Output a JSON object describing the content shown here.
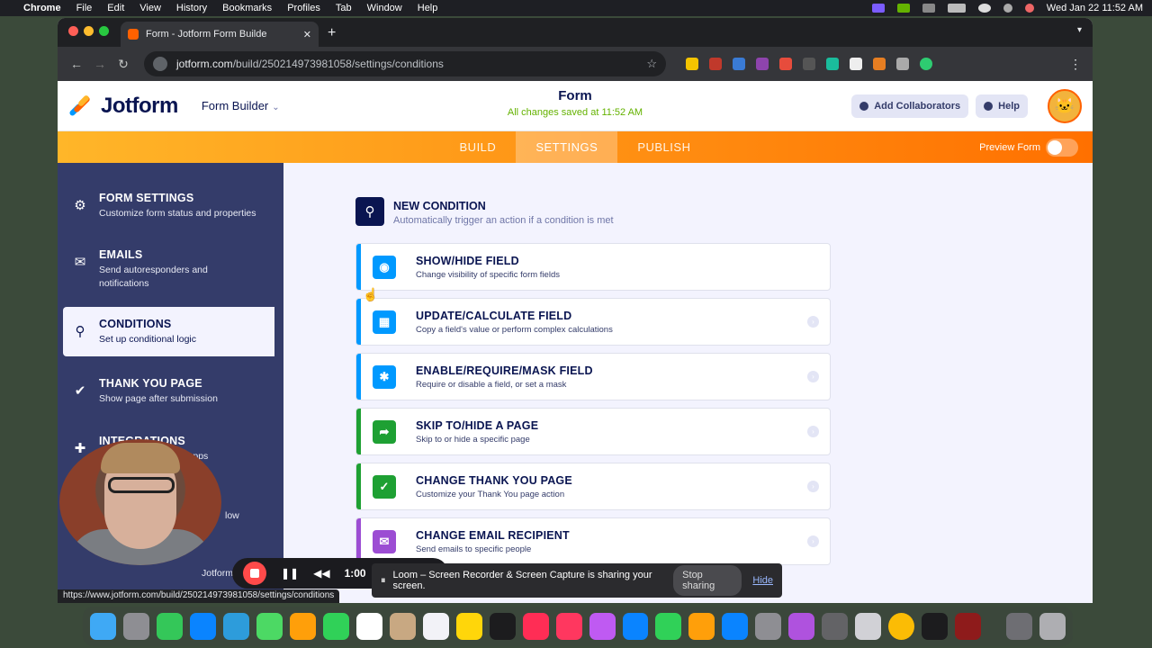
{
  "menubar": {
    "app": "Chrome",
    "items": [
      "File",
      "Edit",
      "View",
      "History",
      "Bookmarks",
      "Profiles",
      "Tab",
      "Window",
      "Help"
    ],
    "clock": "Wed Jan 22  11:52 AM"
  },
  "browser": {
    "tab_title": "Form - Jotform Form Builde",
    "new_tab": "+",
    "url_host": "jotform.com",
    "url_path": "/build/250214973981058/settings/conditions",
    "status_url": "https://www.jotform.com/build/250214973981058/settings/conditions"
  },
  "header": {
    "brand": "Jotform",
    "form_builder": "Form Builder",
    "form_title": "Form",
    "save_status": "All changes saved at 11:52 AM",
    "add_collaborators": "Add Collaborators",
    "help": "Help"
  },
  "nav": {
    "tabs": [
      "BUILD",
      "SETTINGS",
      "PUBLISH"
    ],
    "active_tab": "SETTINGS",
    "preview_label": "Preview Form",
    "preview_on": false
  },
  "sidebar": {
    "items": [
      {
        "title": "FORM SETTINGS",
        "desc": "Customize form status and properties",
        "icon": "gear-icon"
      },
      {
        "title": "EMAILS",
        "desc": "Send autoresponders and notifications",
        "icon": "mail-icon"
      },
      {
        "title": "CONDITIONS",
        "desc": "Set up conditional logic",
        "icon": "sitemap-icon",
        "active": true
      },
      {
        "title": "THANK YOU PAGE",
        "desc": "Show page after submission",
        "icon": "check-circle-icon"
      },
      {
        "title": "INTEGRATIONS",
        "desc": "to other apps",
        "icon": "puzzle-icon"
      },
      {
        "title": "",
        "desc": "low",
        "icon": ""
      },
      {
        "title": "",
        "desc": "Jotform",
        "icon": ""
      }
    ]
  },
  "content": {
    "new_condition_title": "NEW CONDITION",
    "new_condition_desc": "Automatically trigger an action if a condition is met",
    "cards": [
      {
        "title": "SHOW/HIDE FIELD",
        "desc": "Change visibility of specific form fields",
        "color": "#0099ff",
        "icon": "eye-icon"
      },
      {
        "title": "UPDATE/CALCULATE FIELD",
        "desc": "Copy a field's value or perform complex calculations",
        "color": "#0099ff",
        "icon": "calculator-icon"
      },
      {
        "title": "ENABLE/REQUIRE/MASK FIELD",
        "desc": "Require or disable a field, or set a mask",
        "color": "#0099ff",
        "icon": "asterisk-icon"
      },
      {
        "title": "SKIP TO/HIDE A PAGE",
        "desc": "Skip to or hide a specific page",
        "color": "#1ea033",
        "icon": "share-arrow-icon"
      },
      {
        "title": "CHANGE THANK YOU PAGE",
        "desc": "Customize your Thank You page action",
        "color": "#1ea033",
        "icon": "check-icon"
      },
      {
        "title": "CHANGE EMAIL RECIPIENT",
        "desc": "Send emails to specific people",
        "color": "#9c4dd3",
        "icon": "envelope-icon"
      }
    ]
  },
  "loom": {
    "timer": "1:00",
    "share_text": "Loom – Screen Recorder & Screen Capture is sharing your screen.",
    "stop_sharing": "Stop sharing",
    "hide": "Hide"
  }
}
